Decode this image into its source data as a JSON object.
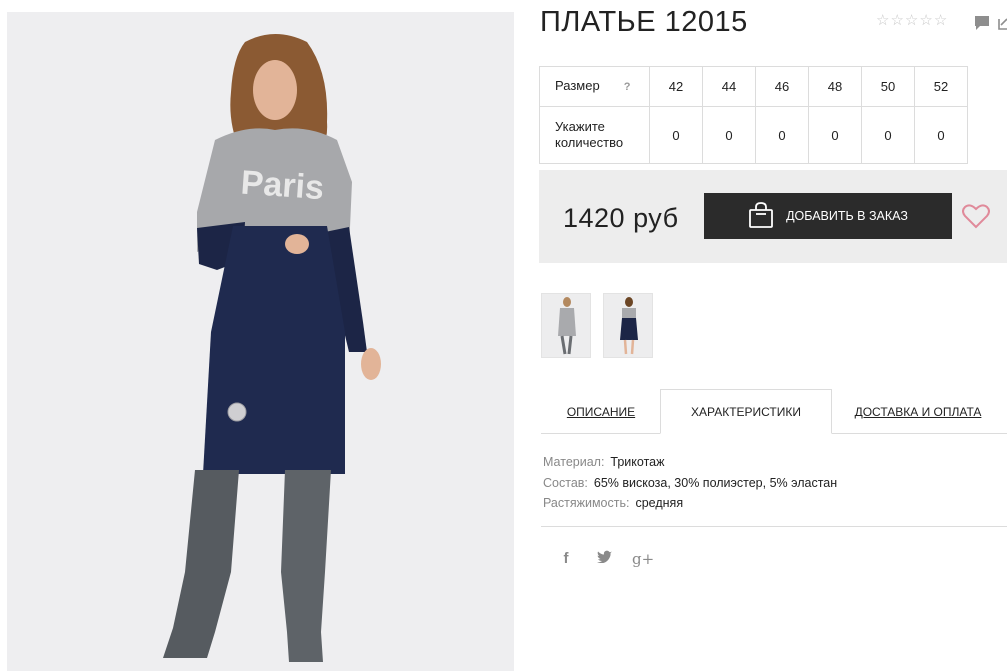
{
  "product": {
    "title": "ПЛАТЬЕ 12015",
    "rating_stars": 5,
    "rating_filled": 0
  },
  "sizes": {
    "size_label": "Размер",
    "help_mark": "?",
    "qty_label": "Укажите количество",
    "values": [
      "42",
      "44",
      "46",
      "48",
      "50",
      "52"
    ],
    "quantities": [
      "0",
      "0",
      "0",
      "0",
      "0",
      "0"
    ]
  },
  "buy": {
    "price": "1420 руб",
    "add_label": "ДОБАВИТЬ В ЗАКАЗ"
  },
  "tabs": {
    "description": "ОПИСАНИЕ",
    "characteristics": "ХАРАКТЕРИСТИКИ",
    "delivery": "ДОСТАВКА И ОПЛАТА",
    "active": "characteristics"
  },
  "specs": [
    {
      "key": "Материал:",
      "value": "Трикотаж"
    },
    {
      "key": "Состав:",
      "value": "65% вискоза, 30% полиэстер, 5% эластан"
    },
    {
      "key": "Растяжимость:",
      "value": "средняя"
    }
  ],
  "social": {
    "facebook": "f",
    "twitter": "t",
    "gplus": "g+"
  },
  "colors": {
    "button_bg": "#2b2b2b",
    "heart": "#e08a9a",
    "panel_bg": "#ededed"
  }
}
